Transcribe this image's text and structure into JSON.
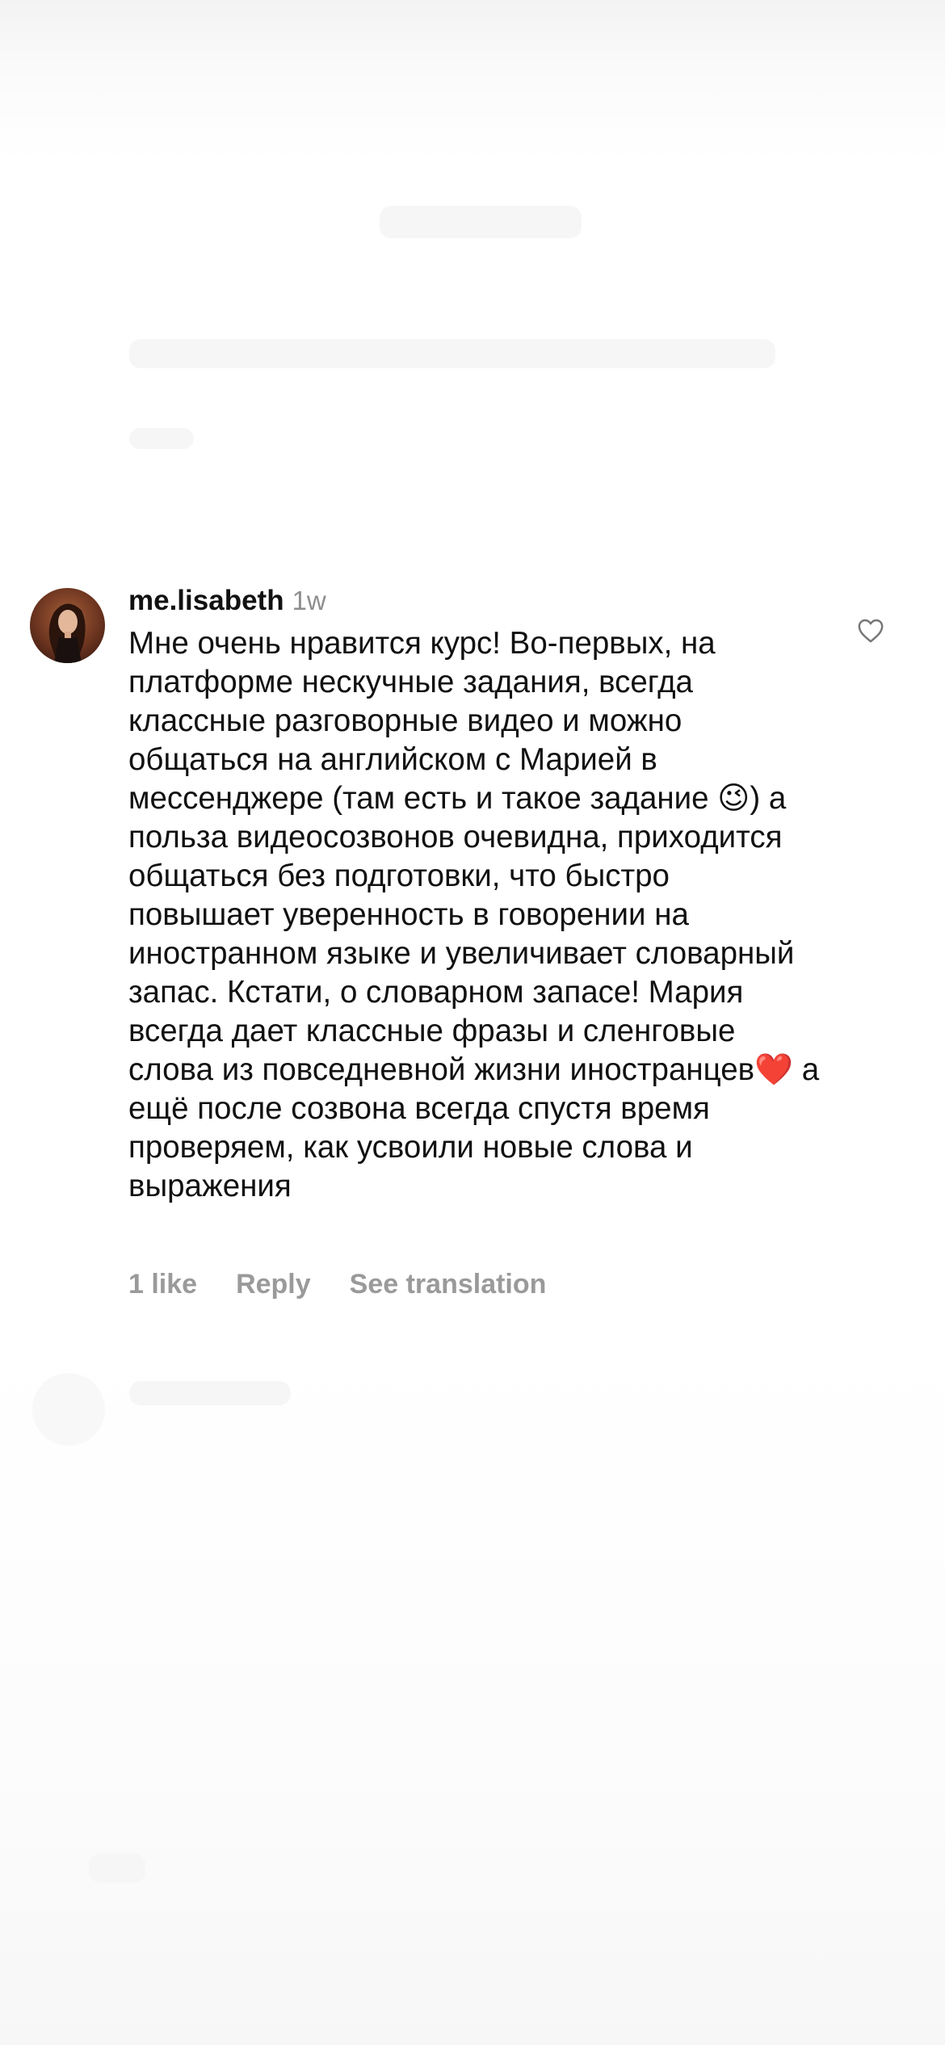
{
  "comment": {
    "username": "me.lisabeth",
    "timestamp": "1w",
    "text": "Мне очень нравится курс! Во-первых, на платформе нескучные задания, всегда классные разговорные видео и можно общаться на английском с Марией в мессенджере (там есть и такое задание 😉) а польза видеосозвонов очевидна, приходится общаться без подготовки, что быстро повышает уверенность в говорении на иностранном языке и увеличивает словарный запас. Кстати, о словарном запасе! Мария всегда дает классные фразы и сленговые слова из повседневной жизни иностранцев❤️ а ещё после созвона всегда спустя время проверяем, как усвоили новые слова и выражения",
    "like_icon": "heart-outline-icon",
    "avatar_icon": "profile-photo",
    "actions": {
      "likes": "1 like",
      "reply": "Reply",
      "see_translation": "See translation"
    }
  },
  "colors": {
    "text": "#111111",
    "secondary": "#8e8e8e",
    "action": "#9a9a9a",
    "background": "#ffffff"
  }
}
